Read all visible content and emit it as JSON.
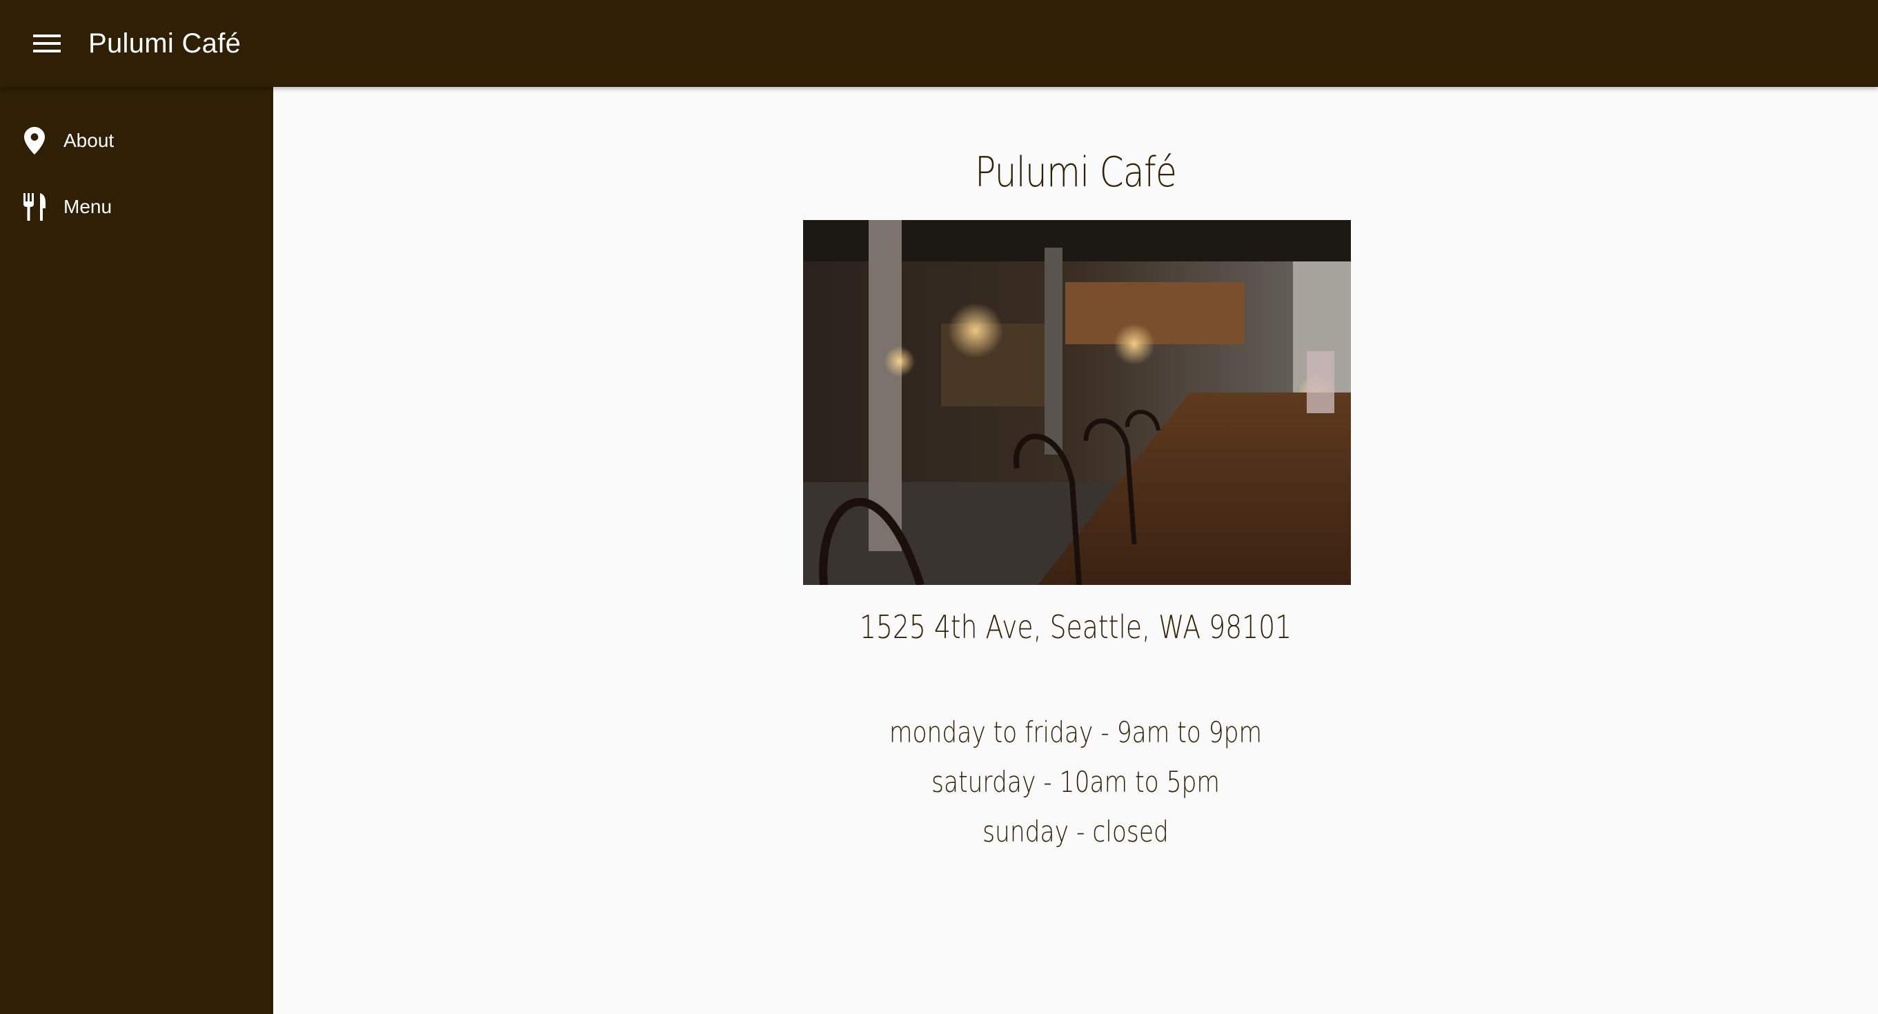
{
  "app_bar": {
    "title": "Pulumi Café",
    "menu_icon": "hamburger-menu-icon"
  },
  "sidebar": {
    "items": [
      {
        "label": "About",
        "icon": "location-pin-icon"
      },
      {
        "label": "Menu",
        "icon": "restaurant-icon"
      }
    ]
  },
  "main": {
    "title": "Pulumi Café",
    "address": "1525 4th Ave, Seattle, WA 98101",
    "hours": [
      "monday to friday - 9am to 9pm",
      "saturday - 10am to 5pm",
      "sunday - closed"
    ]
  },
  "colors": {
    "brand_dark": "#2e1f05",
    "background": "#fafafa",
    "text_on_dark": "#ffffff"
  }
}
